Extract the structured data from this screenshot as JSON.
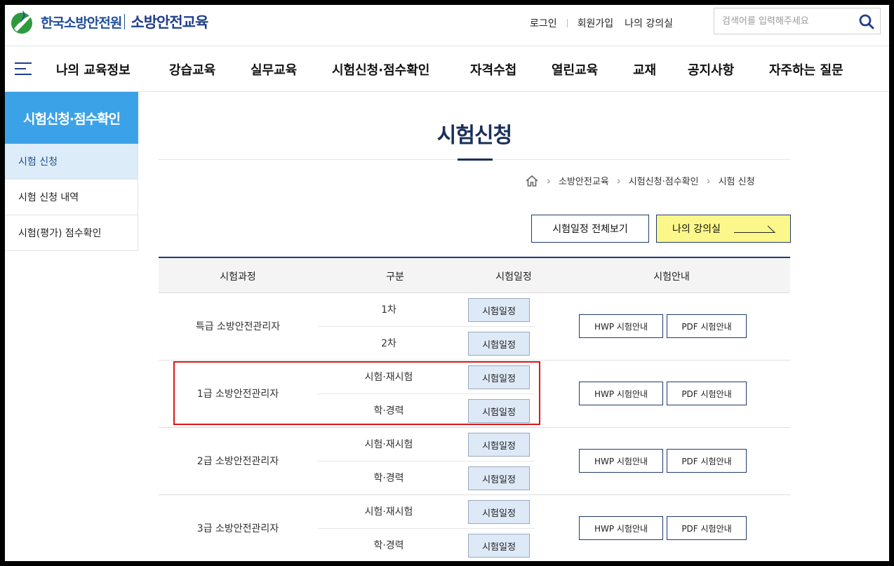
{
  "header": {
    "org_name": "한국소방안전원",
    "site_name": "소방안전교육",
    "util_links": [
      "로그인",
      "회원가입",
      "나의 강의실"
    ],
    "search_placeholder": "검색어를 입력해주세요"
  },
  "nav": {
    "items": [
      "나의 교육정보",
      "강습교육",
      "실무교육",
      "시험신청·점수확인",
      "자격수첩",
      "열린교육",
      "교재",
      "공지사항",
      "자주하는 질문"
    ]
  },
  "sidebar": {
    "title": "시험신청·점수확인",
    "items": [
      {
        "label": "시험 신청",
        "active": true
      },
      {
        "label": "시험 신청 내역",
        "active": false
      },
      {
        "label": "시험(평가) 점수확인",
        "active": false
      }
    ]
  },
  "main": {
    "title": "시험신청",
    "breadcrumb": [
      "소방안전교육",
      "시험신청·점수확인",
      "시험 신청"
    ],
    "btn_all_schedule": "시험일정 전체보기",
    "btn_my_classroom": "나의 강의실",
    "table": {
      "headers": [
        "시험과정",
        "구분",
        "시험일정",
        "시험안내"
      ],
      "rows": [
        {
          "course": "특급 소방안전관리자",
          "types": [
            "1차",
            "2차"
          ]
        },
        {
          "course": "1급 소방안전관리자",
          "types": [
            "시험·재시험",
            "학·경력"
          ]
        },
        {
          "course": "2급 소방안전관리자",
          "types": [
            "시험·재시험",
            "학·경력"
          ]
        },
        {
          "course": "3급 소방안전관리자",
          "types": [
            "시험·재시험",
            "학·경력"
          ]
        }
      ],
      "schedule_btn": "시험일정",
      "hwp_btn": "HWP 시험안내",
      "pdf_btn": "PDF 시험안내"
    }
  },
  "colors": {
    "sidebar_accent": "#3ca2e8",
    "navy": "#1a2f5a",
    "my_classroom_bg": "#fbf78a",
    "highlight": "#e01515"
  }
}
